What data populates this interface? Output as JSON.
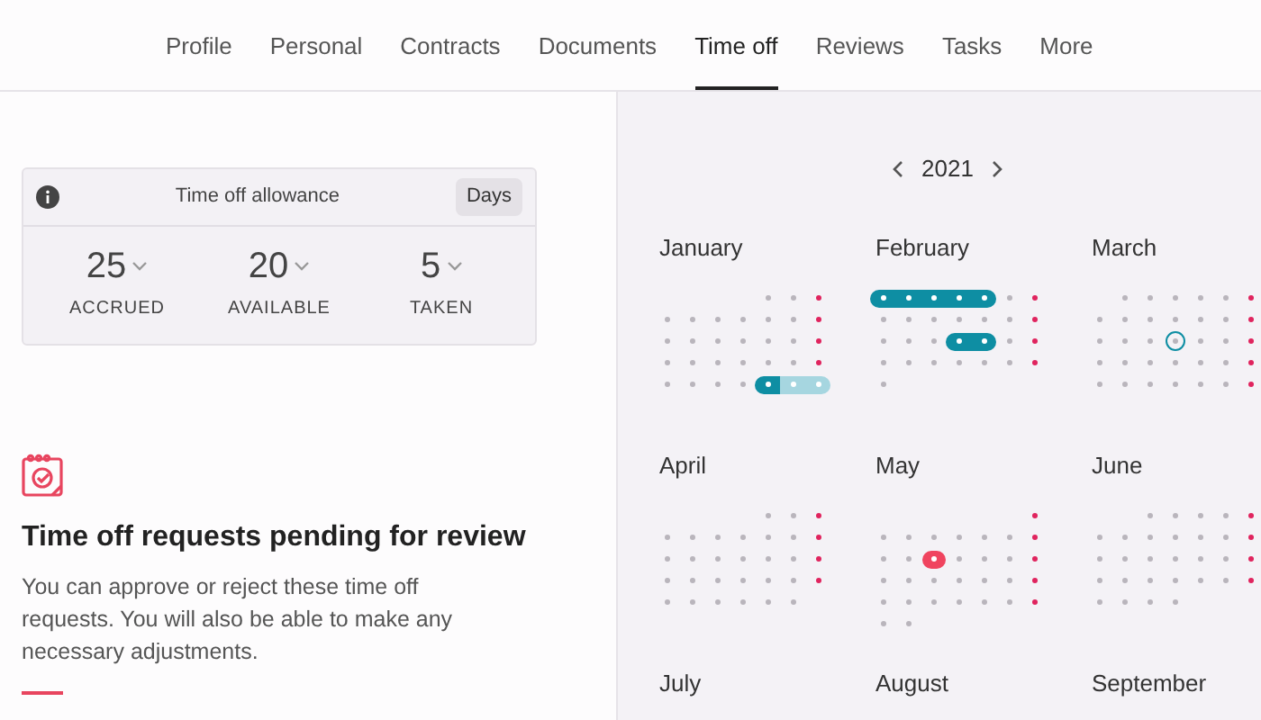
{
  "tabs": [
    {
      "label": "Profile",
      "selected": false
    },
    {
      "label": "Personal",
      "selected": false
    },
    {
      "label": "Contracts",
      "selected": false
    },
    {
      "label": "Documents",
      "selected": false
    },
    {
      "label": "Time off",
      "selected": true
    },
    {
      "label": "Reviews",
      "selected": false
    },
    {
      "label": "Tasks",
      "selected": false
    },
    {
      "label": "More",
      "selected": false
    }
  ],
  "allowance": {
    "title": "Time off allowance",
    "unit_button": "Days",
    "stats": [
      {
        "value": "25",
        "label": "ACCRUED"
      },
      {
        "value": "20",
        "label": "AVAILABLE"
      },
      {
        "value": "5",
        "label": "TAKEN"
      }
    ]
  },
  "pending": {
    "heading": "Time off requests pending for review",
    "body": "You can approve or reject these time off requests. You will also be able to make any necessary adjustments."
  },
  "calendar": {
    "year": "2021",
    "months": [
      {
        "name": "January",
        "weeks": [
          [
            {
              "kind": "blank"
            },
            {
              "kind": "blank"
            },
            {
              "kind": "blank"
            },
            {
              "kind": "blank"
            },
            {
              "kind": "day"
            },
            {
              "kind": "day"
            },
            {
              "kind": "weekend"
            }
          ],
          [
            {
              "kind": "day"
            },
            {
              "kind": "day"
            },
            {
              "kind": "day"
            },
            {
              "kind": "day"
            },
            {
              "kind": "day"
            },
            {
              "kind": "day"
            },
            {
              "kind": "weekend"
            }
          ],
          [
            {
              "kind": "day"
            },
            {
              "kind": "day"
            },
            {
              "kind": "day"
            },
            {
              "kind": "day"
            },
            {
              "kind": "day"
            },
            {
              "kind": "day"
            },
            {
              "kind": "weekend"
            }
          ],
          [
            {
              "kind": "day"
            },
            {
              "kind": "day"
            },
            {
              "kind": "day"
            },
            {
              "kind": "day"
            },
            {
              "kind": "day"
            },
            {
              "kind": "day"
            },
            {
              "kind": "weekend"
            }
          ],
          [
            {
              "kind": "day"
            },
            {
              "kind": "day"
            },
            {
              "kind": "day"
            },
            {
              "kind": "day"
            },
            {
              "kind": "off"
            },
            {
              "kind": "pending"
            },
            {
              "kind": "pending"
            }
          ]
        ]
      },
      {
        "name": "February",
        "weeks": [
          [
            {
              "kind": "off"
            },
            {
              "kind": "off"
            },
            {
              "kind": "off"
            },
            {
              "kind": "off"
            },
            {
              "kind": "off"
            },
            {
              "kind": "day"
            },
            {
              "kind": "weekend"
            }
          ],
          [
            {
              "kind": "day"
            },
            {
              "kind": "day"
            },
            {
              "kind": "day"
            },
            {
              "kind": "day"
            },
            {
              "kind": "day"
            },
            {
              "kind": "day"
            },
            {
              "kind": "weekend"
            }
          ],
          [
            {
              "kind": "day"
            },
            {
              "kind": "day"
            },
            {
              "kind": "day"
            },
            {
              "kind": "off"
            },
            {
              "kind": "off"
            },
            {
              "kind": "day"
            },
            {
              "kind": "weekend"
            }
          ],
          [
            {
              "kind": "day"
            },
            {
              "kind": "day"
            },
            {
              "kind": "day"
            },
            {
              "kind": "day"
            },
            {
              "kind": "day"
            },
            {
              "kind": "day"
            },
            {
              "kind": "weekend"
            }
          ],
          [
            {
              "kind": "day"
            }
          ]
        ]
      },
      {
        "name": "March",
        "weeks": [
          [
            {
              "kind": "blank"
            },
            {
              "kind": "day"
            },
            {
              "kind": "day"
            },
            {
              "kind": "day"
            },
            {
              "kind": "day"
            },
            {
              "kind": "day"
            },
            {
              "kind": "weekend"
            }
          ],
          [
            {
              "kind": "day"
            },
            {
              "kind": "day"
            },
            {
              "kind": "day"
            },
            {
              "kind": "day"
            },
            {
              "kind": "day"
            },
            {
              "kind": "day"
            },
            {
              "kind": "weekend"
            }
          ],
          [
            {
              "kind": "day"
            },
            {
              "kind": "day"
            },
            {
              "kind": "day"
            },
            {
              "kind": "today"
            },
            {
              "kind": "day"
            },
            {
              "kind": "day"
            },
            {
              "kind": "weekend"
            }
          ],
          [
            {
              "kind": "day"
            },
            {
              "kind": "day"
            },
            {
              "kind": "day"
            },
            {
              "kind": "day"
            },
            {
              "kind": "day"
            },
            {
              "kind": "day"
            },
            {
              "kind": "weekend"
            }
          ],
          [
            {
              "kind": "day"
            },
            {
              "kind": "day"
            },
            {
              "kind": "day"
            },
            {
              "kind": "day"
            },
            {
              "kind": "day"
            },
            {
              "kind": "day"
            },
            {
              "kind": "weekend"
            }
          ]
        ]
      },
      {
        "name": "April",
        "weeks": [
          [
            {
              "kind": "blank"
            },
            {
              "kind": "blank"
            },
            {
              "kind": "blank"
            },
            {
              "kind": "blank"
            },
            {
              "kind": "day"
            },
            {
              "kind": "day"
            },
            {
              "kind": "weekend"
            }
          ],
          [
            {
              "kind": "day"
            },
            {
              "kind": "day"
            },
            {
              "kind": "day"
            },
            {
              "kind": "day"
            },
            {
              "kind": "day"
            },
            {
              "kind": "day"
            },
            {
              "kind": "weekend"
            }
          ],
          [
            {
              "kind": "day"
            },
            {
              "kind": "day"
            },
            {
              "kind": "day"
            },
            {
              "kind": "day"
            },
            {
              "kind": "day"
            },
            {
              "kind": "day"
            },
            {
              "kind": "weekend"
            }
          ],
          [
            {
              "kind": "day"
            },
            {
              "kind": "day"
            },
            {
              "kind": "day"
            },
            {
              "kind": "day"
            },
            {
              "kind": "day"
            },
            {
              "kind": "day"
            },
            {
              "kind": "weekend"
            }
          ],
          [
            {
              "kind": "day"
            },
            {
              "kind": "day"
            },
            {
              "kind": "day"
            },
            {
              "kind": "day"
            },
            {
              "kind": "day"
            },
            {
              "kind": "day"
            }
          ]
        ]
      },
      {
        "name": "May",
        "weeks": [
          [
            {
              "kind": "blank"
            },
            {
              "kind": "blank"
            },
            {
              "kind": "blank"
            },
            {
              "kind": "blank"
            },
            {
              "kind": "blank"
            },
            {
              "kind": "blank"
            },
            {
              "kind": "weekend"
            }
          ],
          [
            {
              "kind": "day"
            },
            {
              "kind": "day"
            },
            {
              "kind": "day"
            },
            {
              "kind": "day"
            },
            {
              "kind": "day"
            },
            {
              "kind": "day"
            },
            {
              "kind": "weekend"
            }
          ],
          [
            {
              "kind": "day"
            },
            {
              "kind": "day"
            },
            {
              "kind": "holiday"
            },
            {
              "kind": "day"
            },
            {
              "kind": "day"
            },
            {
              "kind": "day"
            },
            {
              "kind": "weekend"
            }
          ],
          [
            {
              "kind": "day"
            },
            {
              "kind": "day"
            },
            {
              "kind": "day"
            },
            {
              "kind": "day"
            },
            {
              "kind": "day"
            },
            {
              "kind": "day"
            },
            {
              "kind": "weekend"
            }
          ],
          [
            {
              "kind": "day"
            },
            {
              "kind": "day"
            },
            {
              "kind": "day"
            },
            {
              "kind": "day"
            },
            {
              "kind": "day"
            },
            {
              "kind": "day"
            },
            {
              "kind": "weekend"
            }
          ],
          [
            {
              "kind": "day"
            },
            {
              "kind": "day"
            }
          ]
        ]
      },
      {
        "name": "June",
        "weeks": [
          [
            {
              "kind": "blank"
            },
            {
              "kind": "blank"
            },
            {
              "kind": "day"
            },
            {
              "kind": "day"
            },
            {
              "kind": "day"
            },
            {
              "kind": "day"
            },
            {
              "kind": "weekend"
            }
          ],
          [
            {
              "kind": "day"
            },
            {
              "kind": "day"
            },
            {
              "kind": "day"
            },
            {
              "kind": "day"
            },
            {
              "kind": "day"
            },
            {
              "kind": "day"
            },
            {
              "kind": "weekend"
            }
          ],
          [
            {
              "kind": "day"
            },
            {
              "kind": "day"
            },
            {
              "kind": "day"
            },
            {
              "kind": "day"
            },
            {
              "kind": "day"
            },
            {
              "kind": "day"
            },
            {
              "kind": "weekend"
            }
          ],
          [
            {
              "kind": "day"
            },
            {
              "kind": "day"
            },
            {
              "kind": "day"
            },
            {
              "kind": "day"
            },
            {
              "kind": "day"
            },
            {
              "kind": "day"
            },
            {
              "kind": "weekend"
            }
          ],
          [
            {
              "kind": "day"
            },
            {
              "kind": "day"
            },
            {
              "kind": "day"
            },
            {
              "kind": "day"
            }
          ]
        ]
      },
      {
        "name": "July"
      },
      {
        "name": "August"
      },
      {
        "name": "September"
      }
    ]
  }
}
